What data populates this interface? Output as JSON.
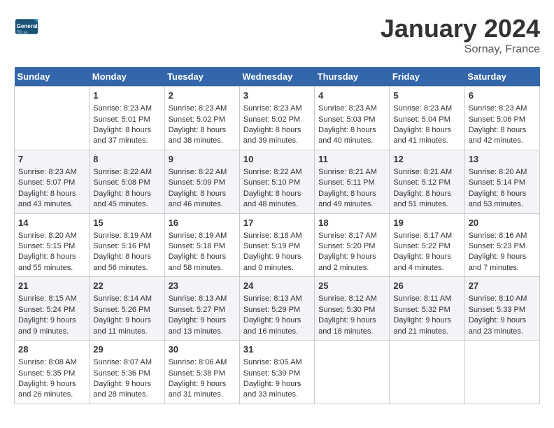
{
  "header": {
    "logo_line1": "General",
    "logo_line2": "Blue",
    "month": "January 2024",
    "location": "Sornay, France"
  },
  "days_of_week": [
    "Sunday",
    "Monday",
    "Tuesday",
    "Wednesday",
    "Thursday",
    "Friday",
    "Saturday"
  ],
  "weeks": [
    [
      {
        "day": null
      },
      {
        "day": "1",
        "sunrise": "Sunrise: 8:23 AM",
        "sunset": "Sunset: 5:01 PM",
        "daylight": "Daylight: 8 hours and 37 minutes."
      },
      {
        "day": "2",
        "sunrise": "Sunrise: 8:23 AM",
        "sunset": "Sunset: 5:02 PM",
        "daylight": "Daylight: 8 hours and 38 minutes."
      },
      {
        "day": "3",
        "sunrise": "Sunrise: 8:23 AM",
        "sunset": "Sunset: 5:02 PM",
        "daylight": "Daylight: 8 hours and 39 minutes."
      },
      {
        "day": "4",
        "sunrise": "Sunrise: 8:23 AM",
        "sunset": "Sunset: 5:03 PM",
        "daylight": "Daylight: 8 hours and 40 minutes."
      },
      {
        "day": "5",
        "sunrise": "Sunrise: 8:23 AM",
        "sunset": "Sunset: 5:04 PM",
        "daylight": "Daylight: 8 hours and 41 minutes."
      },
      {
        "day": "6",
        "sunrise": "Sunrise: 8:23 AM",
        "sunset": "Sunset: 5:06 PM",
        "daylight": "Daylight: 8 hours and 42 minutes."
      }
    ],
    [
      {
        "day": "7",
        "sunrise": "Sunrise: 8:23 AM",
        "sunset": "Sunset: 5:07 PM",
        "daylight": "Daylight: 8 hours and 43 minutes."
      },
      {
        "day": "8",
        "sunrise": "Sunrise: 8:22 AM",
        "sunset": "Sunset: 5:08 PM",
        "daylight": "Daylight: 8 hours and 45 minutes."
      },
      {
        "day": "9",
        "sunrise": "Sunrise: 8:22 AM",
        "sunset": "Sunset: 5:09 PM",
        "daylight": "Daylight: 8 hours and 46 minutes."
      },
      {
        "day": "10",
        "sunrise": "Sunrise: 8:22 AM",
        "sunset": "Sunset: 5:10 PM",
        "daylight": "Daylight: 8 hours and 48 minutes."
      },
      {
        "day": "11",
        "sunrise": "Sunrise: 8:21 AM",
        "sunset": "Sunset: 5:11 PM",
        "daylight": "Daylight: 8 hours and 49 minutes."
      },
      {
        "day": "12",
        "sunrise": "Sunrise: 8:21 AM",
        "sunset": "Sunset: 5:12 PM",
        "daylight": "Daylight: 8 hours and 51 minutes."
      },
      {
        "day": "13",
        "sunrise": "Sunrise: 8:20 AM",
        "sunset": "Sunset: 5:14 PM",
        "daylight": "Daylight: 8 hours and 53 minutes."
      }
    ],
    [
      {
        "day": "14",
        "sunrise": "Sunrise: 8:20 AM",
        "sunset": "Sunset: 5:15 PM",
        "daylight": "Daylight: 8 hours and 55 minutes."
      },
      {
        "day": "15",
        "sunrise": "Sunrise: 8:19 AM",
        "sunset": "Sunset: 5:16 PM",
        "daylight": "Daylight: 8 hours and 56 minutes."
      },
      {
        "day": "16",
        "sunrise": "Sunrise: 8:19 AM",
        "sunset": "Sunset: 5:18 PM",
        "daylight": "Daylight: 8 hours and 58 minutes."
      },
      {
        "day": "17",
        "sunrise": "Sunrise: 8:18 AM",
        "sunset": "Sunset: 5:19 PM",
        "daylight": "Daylight: 9 hours and 0 minutes."
      },
      {
        "day": "18",
        "sunrise": "Sunrise: 8:17 AM",
        "sunset": "Sunset: 5:20 PM",
        "daylight": "Daylight: 9 hours and 2 minutes."
      },
      {
        "day": "19",
        "sunrise": "Sunrise: 8:17 AM",
        "sunset": "Sunset: 5:22 PM",
        "daylight": "Daylight: 9 hours and 4 minutes."
      },
      {
        "day": "20",
        "sunrise": "Sunrise: 8:16 AM",
        "sunset": "Sunset: 5:23 PM",
        "daylight": "Daylight: 9 hours and 7 minutes."
      }
    ],
    [
      {
        "day": "21",
        "sunrise": "Sunrise: 8:15 AM",
        "sunset": "Sunset: 5:24 PM",
        "daylight": "Daylight: 9 hours and 9 minutes."
      },
      {
        "day": "22",
        "sunrise": "Sunrise: 8:14 AM",
        "sunset": "Sunset: 5:26 PM",
        "daylight": "Daylight: 9 hours and 11 minutes."
      },
      {
        "day": "23",
        "sunrise": "Sunrise: 8:13 AM",
        "sunset": "Sunset: 5:27 PM",
        "daylight": "Daylight: 9 hours and 13 minutes."
      },
      {
        "day": "24",
        "sunrise": "Sunrise: 8:13 AM",
        "sunset": "Sunset: 5:29 PM",
        "daylight": "Daylight: 9 hours and 16 minutes."
      },
      {
        "day": "25",
        "sunrise": "Sunrise: 8:12 AM",
        "sunset": "Sunset: 5:30 PM",
        "daylight": "Daylight: 9 hours and 18 minutes."
      },
      {
        "day": "26",
        "sunrise": "Sunrise: 8:11 AM",
        "sunset": "Sunset: 5:32 PM",
        "daylight": "Daylight: 9 hours and 21 minutes."
      },
      {
        "day": "27",
        "sunrise": "Sunrise: 8:10 AM",
        "sunset": "Sunset: 5:33 PM",
        "daylight": "Daylight: 9 hours and 23 minutes."
      }
    ],
    [
      {
        "day": "28",
        "sunrise": "Sunrise: 8:08 AM",
        "sunset": "Sunset: 5:35 PM",
        "daylight": "Daylight: 9 hours and 26 minutes."
      },
      {
        "day": "29",
        "sunrise": "Sunrise: 8:07 AM",
        "sunset": "Sunset: 5:36 PM",
        "daylight": "Daylight: 9 hours and 28 minutes."
      },
      {
        "day": "30",
        "sunrise": "Sunrise: 8:06 AM",
        "sunset": "Sunset: 5:38 PM",
        "daylight": "Daylight: 9 hours and 31 minutes."
      },
      {
        "day": "31",
        "sunrise": "Sunrise: 8:05 AM",
        "sunset": "Sunset: 5:39 PM",
        "daylight": "Daylight: 9 hours and 33 minutes."
      },
      {
        "day": null
      },
      {
        "day": null
      },
      {
        "day": null
      }
    ]
  ]
}
